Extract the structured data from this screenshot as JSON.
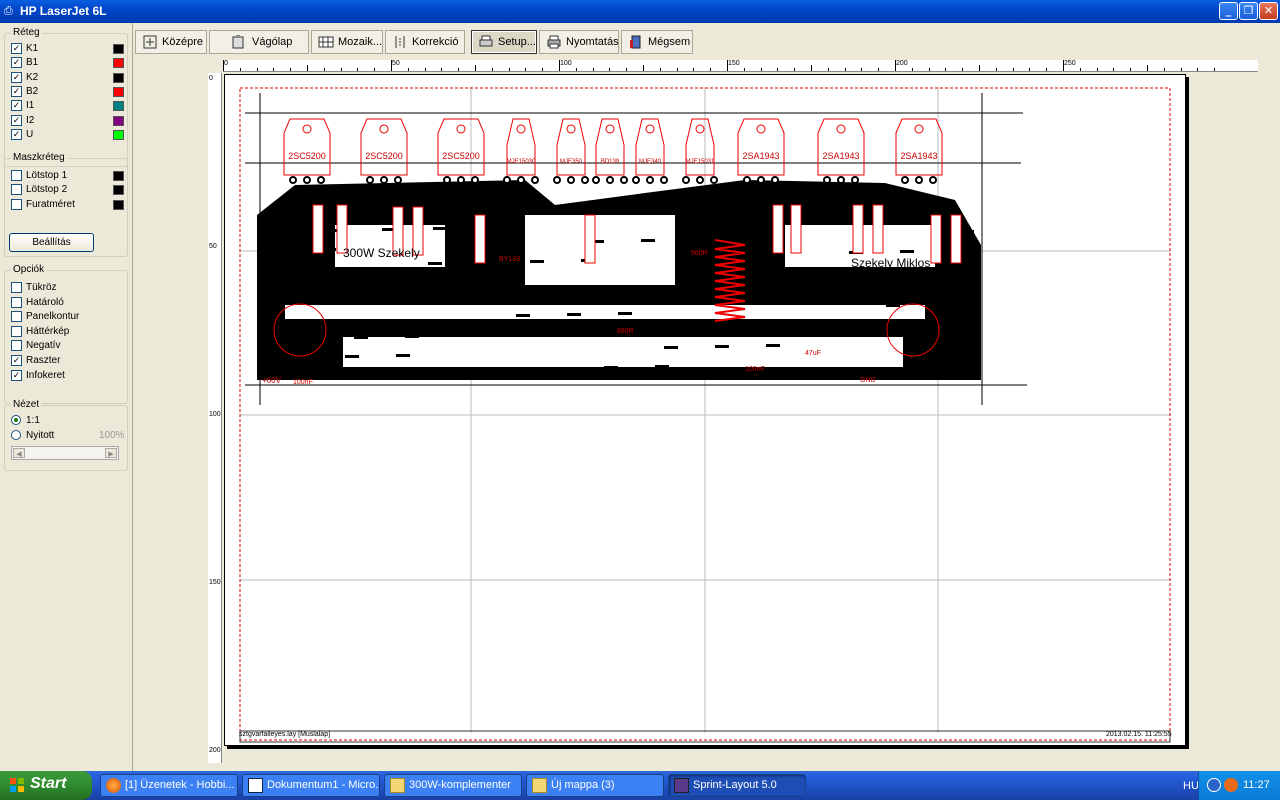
{
  "window": {
    "title": "HP LaserJet 6L"
  },
  "layers": {
    "title": "Réteg",
    "items": [
      {
        "label": "K1",
        "checked": true,
        "color": "#000000"
      },
      {
        "label": "B1",
        "checked": true,
        "color": "#ff0000"
      },
      {
        "label": "K2",
        "checked": true,
        "color": "#000000"
      },
      {
        "label": "B2",
        "checked": true,
        "color": "#ff0000"
      },
      {
        "label": "I1",
        "checked": true,
        "color": "#008080"
      },
      {
        "label": "I2",
        "checked": true,
        "color": "#800080"
      },
      {
        "label": "U",
        "checked": true,
        "color": "#00ff00"
      }
    ]
  },
  "mask": {
    "title": "Maszkréteg",
    "items": [
      {
        "label": "Lötstop 1",
        "checked": false,
        "color": "#000000"
      },
      {
        "label": "Lötstop 2",
        "checked": false,
        "color": "#000000"
      },
      {
        "label": "Furatméret",
        "checked": false,
        "color": "#000000"
      }
    ],
    "settings_button": "Beállítás"
  },
  "options": {
    "title": "Opciók",
    "items": [
      {
        "label": "Tükröz",
        "checked": false
      },
      {
        "label": "Határoló",
        "checked": false
      },
      {
        "label": "Panelkontur",
        "checked": false
      },
      {
        "label": "Háttérkép",
        "checked": false
      },
      {
        "label": "Negatív",
        "checked": false
      },
      {
        "label": "Raszter",
        "checked": true
      },
      {
        "label": "Infokeret",
        "checked": true
      }
    ]
  },
  "view": {
    "title": "Nézet",
    "opt1": "1:1",
    "opt2": "Nyitott",
    "percent": "100%"
  },
  "toolbar": {
    "kozepre": "Középre",
    "vagolap": "Vágólap",
    "mozaik": "Mozaik...",
    "korrekcio": "Korrekció",
    "setup": "Setup...",
    "nyomtatas": "Nyomtatás",
    "megsem": "Mégsem",
    "help": "?"
  },
  "ruler": {
    "top": [
      "0",
      "50",
      "100",
      "150",
      "200",
      "250"
    ],
    "left": [
      "0",
      "50",
      "100",
      "150",
      "200"
    ]
  },
  "page": {
    "footer_left": "sztgvarfalleyes.lay [Muslalap]",
    "footer_right": "2013.02.15. 11:25:55"
  },
  "pcb": {
    "transistors_top": [
      "2SC5200",
      "2SC5200",
      "2SC5200",
      "MJE15030",
      "MJE350",
      "BD139",
      "MJE340",
      "MJE15031",
      "2SA1943",
      "2SA1943",
      "2SA1943"
    ],
    "labels": [
      "300W Szekely",
      "Szekely Miklos",
      "+60V",
      "-60V",
      "GND",
      "100nF",
      "47uF",
      "BY133",
      "560R",
      "680R",
      "100nF"
    ]
  },
  "taskbar": {
    "start": "Start",
    "tasks": [
      {
        "label": "[1] Üzenetek - Hobbi..."
      },
      {
        "label": "Dokumentum1 - Micro..."
      },
      {
        "label": "300W-komplementer"
      },
      {
        "label": "Új mappa (3)"
      },
      {
        "label": "Sprint-Layout 5.0"
      }
    ],
    "lang": "HU",
    "clock": "11:27"
  }
}
